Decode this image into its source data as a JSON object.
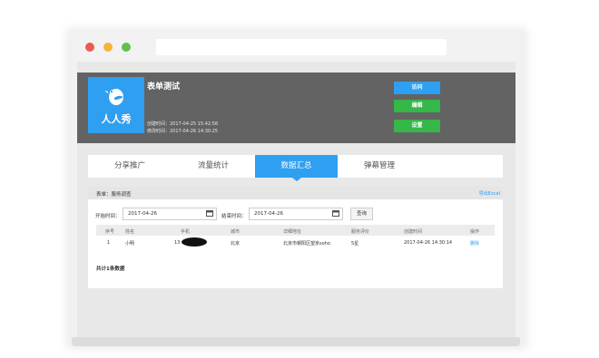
{
  "form": {
    "title": "表单测试",
    "logo_text": "人人秀",
    "created": "创建时间：2017-04-25 15:42:58",
    "modified": "修改时间：2017-04-26 14:30:25"
  },
  "header_buttons": {
    "visit": "访问",
    "edit": "编辑",
    "settings": "设置"
  },
  "tabs": [
    {
      "label": "分享推广",
      "active": false
    },
    {
      "label": "流量统计",
      "active": false
    },
    {
      "label": "数据汇总",
      "active": true
    },
    {
      "label": "弹幕管理",
      "active": false
    }
  ],
  "panel": {
    "title": "表单：服务调查",
    "export": "导出Excel"
  },
  "filter": {
    "start_label": "开始时间：",
    "start_value": "2017-04-26",
    "end_label": "结束时间：",
    "end_value": "2017-04-26",
    "query_button": "查询"
  },
  "table": {
    "headers": [
      "序号",
      "姓名",
      "手机",
      "城市",
      "详细地址",
      "服务评价",
      "创建时间",
      "操作"
    ],
    "rows": [
      {
        "no": "1",
        "name": "小明",
        "phone": "13",
        "city": "北京",
        "address": "北京市朝阳区望京soho",
        "rating": "5星",
        "created": "2017-04-26 14:30:14",
        "action": "删除"
      }
    ],
    "total": "共计1条数据"
  },
  "colors": {
    "accent_blue": "#2f9ff2",
    "accent_green": "#35b749",
    "header_gray": "#636363"
  }
}
